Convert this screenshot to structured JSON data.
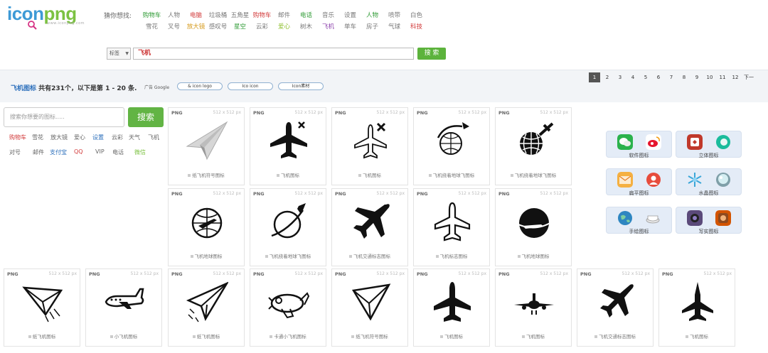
{
  "header": {
    "logo_a": "icon",
    "logo_b": "png",
    "logo_sub": "www.iconpng.com",
    "guess_label": "猜你想找:",
    "row1": [
      {
        "t": "购物车",
        "c": "#2f9b35"
      },
      {
        "t": "人物",
        "c": "#777"
      },
      {
        "t": "电脑",
        "c": "#d23b3b"
      },
      {
        "t": "垃圾桶",
        "c": "#777"
      },
      {
        "t": "五角星",
        "c": "#777"
      },
      {
        "t": "购物车",
        "c": "#d23b3b"
      },
      {
        "t": "邮件",
        "c": "#777"
      },
      {
        "t": "电话",
        "c": "#2f9b35"
      },
      {
        "t": "音乐",
        "c": "#777"
      },
      {
        "t": "设置",
        "c": "#777"
      },
      {
        "t": "人物",
        "c": "#2f9b35"
      },
      {
        "t": "喷带",
        "c": "#777"
      },
      {
        "t": "白色",
        "c": "#777"
      }
    ],
    "row2": [
      {
        "t": "雪花",
        "c": "#777"
      },
      {
        "t": "叉号",
        "c": "#777"
      },
      {
        "t": "放大镜",
        "c": "#d69b1e"
      },
      {
        "t": "感叹号",
        "c": "#777"
      },
      {
        "t": "星空",
        "c": "#2f9b35"
      },
      {
        "t": "云彩",
        "c": "#777"
      },
      {
        "t": "爱心",
        "c": "#8cbf2a"
      },
      {
        "t": "树木",
        "c": "#777"
      },
      {
        "t": "飞机",
        "c": "#8e44ad"
      },
      {
        "t": "单车",
        "c": "#777"
      },
      {
        "t": "房子",
        "c": "#777"
      },
      {
        "t": "气球",
        "c": "#777"
      },
      {
        "t": "科技",
        "c": "#d23b3b"
      }
    ]
  },
  "search": {
    "select": "标签",
    "query": "飞机",
    "button": "搜 索"
  },
  "results": {
    "keyword": "飞机图标",
    "summary": " 共有231个，以下是第 1 - 20 条.",
    "ad_label": "广告 Google",
    "ad_links": [
      "& icon logo",
      "Ico icon",
      "Icon素材"
    ],
    "pages": [
      "1",
      "2",
      "3",
      "4",
      "5",
      "6",
      "7",
      "8",
      "9",
      "10",
      "11",
      "12",
      "下一"
    ]
  },
  "left": {
    "placeholder": "搜索你想要的图标.....",
    "button": "搜索",
    "tags1": [
      {
        "t": "购物车",
        "c": "#d23b3b"
      },
      {
        "t": "雪花",
        "c": "#666"
      },
      {
        "t": "放大镜",
        "c": "#666"
      },
      {
        "t": "爱心",
        "c": "#666"
      },
      {
        "t": "设置",
        "c": "#2a6ebb"
      },
      {
        "t": "云彩",
        "c": "#666"
      },
      {
        "t": "天气",
        "c": "#666"
      },
      {
        "t": "飞机",
        "c": "#666"
      }
    ],
    "tags2": [
      {
        "t": "对号",
        "c": "#666"
      },
      {
        "t": "邮件",
        "c": "#666"
      },
      {
        "t": "支付宝",
        "c": "#2a6ebb"
      },
      {
        "t": "QQ",
        "c": "#d23b3b"
      },
      {
        "t": "VIP",
        "c": "#666"
      },
      {
        "t": "电话",
        "c": "#666"
      },
      {
        "t": "微信",
        "c": "#7cc242"
      }
    ]
  },
  "icons": [
    {
      "fmt": "PNG",
      "size": "512 x 512 px",
      "caption": "纸飞机符号图标",
      "icon": "paper-plane-gray-icon"
    },
    {
      "fmt": "PNG",
      "size": "512 x 512 px",
      "caption": "飞机图标",
      "icon": "airplane-x-icon"
    },
    {
      "fmt": "PNG",
      "size": "512 x 512 px",
      "caption": "飞机图标",
      "icon": "airplane-outline-x-icon"
    },
    {
      "fmt": "PNG",
      "size": "512 x 512 px",
      "caption": "飞机绕着地球飞图标",
      "icon": "globe-plane-orbit-icon"
    },
    {
      "fmt": "PNG",
      "size": "512 x 512 px",
      "caption": "飞机绕着地球飞图标",
      "icon": "globe-plane-bold-icon"
    },
    {
      "fmt": "PNG",
      "size": "512 x 512 px",
      "caption": "飞机地球图标",
      "icon": "globe-plane-icon"
    },
    {
      "fmt": "PNG",
      "size": "512 x 512 px",
      "caption": "飞机绕着地球飞图标",
      "icon": "planet-plane-icon"
    },
    {
      "fmt": "PNG",
      "size": "512 x 512 px",
      "caption": "飞机交通标志图标",
      "icon": "airplane-solid-icon"
    },
    {
      "fmt": "PNG",
      "size": "512 x 512 px",
      "caption": "飞机标志图标",
      "icon": "airplane-outline-icon"
    },
    {
      "fmt": "PNG",
      "size": "512 x 512 px",
      "caption": "飞机地球图标",
      "icon": "globe-solid-plane-icon"
    },
    {
      "fmt": "PNG",
      "size": "512 x 512 px",
      "caption": "纸飞机图标",
      "icon": "paper-plane-sketch-icon"
    },
    {
      "fmt": "PNG",
      "size": "512 x 512 px",
      "caption": "小飞机图标",
      "icon": "small-airplane-icon"
    },
    {
      "fmt": "PNG",
      "size": "512 x 512 px",
      "caption": "纸飞机图标",
      "icon": "paper-plane-hand-icon"
    },
    {
      "fmt": "PNG",
      "size": "512 x 512 px",
      "caption": "卡通小飞机图标",
      "icon": "cartoon-airplane-icon"
    },
    {
      "fmt": "PNG",
      "size": "512 x 512 px",
      "caption": "纸飞机符号图标",
      "icon": "paper-plane-outline-icon"
    },
    {
      "fmt": "PNG",
      "size": "512 x 512 px",
      "caption": "飞机图标",
      "icon": "airplane-top-icon"
    },
    {
      "fmt": "PNG",
      "size": "512 x 512 px",
      "caption": "飞机图标",
      "icon": "airplane-front-icon"
    },
    {
      "fmt": "PNG",
      "size": "512 x 512 px",
      "caption": "飞机交通标志图标",
      "icon": "airplane-diagonal-icon"
    },
    {
      "fmt": "PNG",
      "size": "512 x 512 px",
      "caption": "飞机图标",
      "icon": "fighter-jet-icon"
    }
  ],
  "categories": [
    {
      "label": "软件图标",
      "a": "wechat-icon",
      "b": "weibo-icon"
    },
    {
      "label": "立体图标",
      "a": "app-3d-icon",
      "b": "edge-icon"
    },
    {
      "label": "扁平图标",
      "a": "mail-icon",
      "b": "user-icon"
    },
    {
      "label": "水晶图标",
      "a": "snowflake-icon",
      "b": "crystal-ball-icon"
    },
    {
      "label": "手绘图标",
      "a": "earth-icon",
      "b": "cup-icon"
    },
    {
      "label": "写实图标",
      "a": "camera-icon",
      "b": "speaker-icon"
    }
  ]
}
